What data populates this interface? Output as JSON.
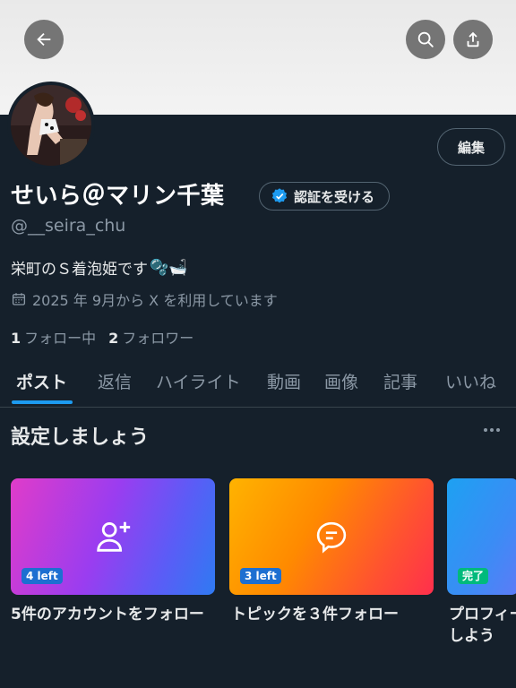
{
  "profile": {
    "edit_label": "編集",
    "name": "せいら＠マリン千葉",
    "verify_label": "認証を受ける",
    "handle": "@__seira_chu",
    "bio": "栄町のＳ着泡姫です",
    "bio_emoji": "🫧🛁",
    "joined": "2025 年 9月から X を利用しています",
    "following_count": "1",
    "following_label": "フォロー中",
    "followers_count": "2",
    "followers_label": "フォロワー"
  },
  "tabs": [
    "ポスト",
    "返信",
    "ハイライト",
    "動画",
    "画像",
    "記事",
    "いいね"
  ],
  "section": {
    "title": "設定しましょう"
  },
  "cards": [
    {
      "label": "5件のアカウントをフォロー",
      "badge": "4 left",
      "icon": "add-user-icon"
    },
    {
      "label": "トピックを３件フォロー",
      "badge": "3 left",
      "icon": "topic-icon"
    },
    {
      "label_line1": "プロフィー",
      "label_line2": "しよう",
      "badge": "完了"
    }
  ],
  "colors": {
    "accent": "#1d9bf0",
    "background": "#15202b",
    "complete_badge": "#00ba7c"
  }
}
